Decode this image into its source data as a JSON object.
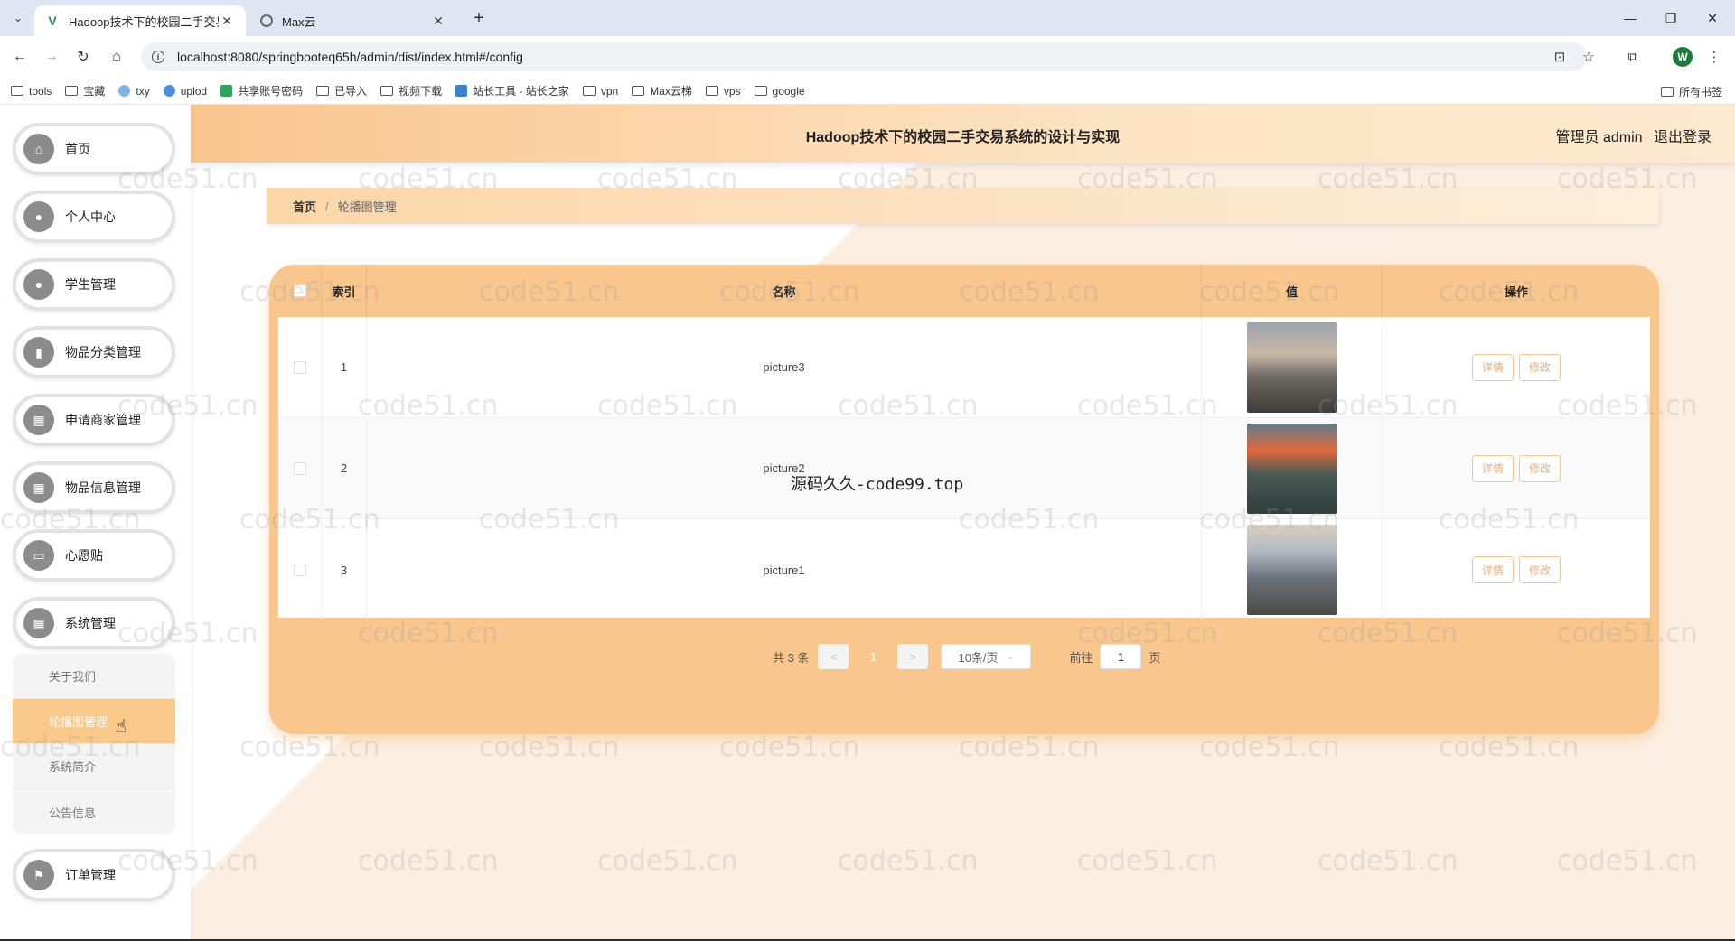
{
  "browser": {
    "tabs": [
      {
        "title": "Hadoop技术下的校园二手交易系统",
        "active": true
      },
      {
        "title": "Max云",
        "active": false
      }
    ],
    "url": "localhost:8080/springbooteq65h/admin/dist/index.html#/config",
    "bookmarks": [
      "tools",
      "宝藏",
      "txy",
      "uplod",
      "共享账号密码",
      "已导入",
      "视频下载",
      "站长工具 - 站长之家",
      "vpn",
      "Max云梯",
      "vps",
      "google"
    ],
    "bookmarks_right": "所有书签",
    "profile_initial": "W"
  },
  "header": {
    "title": "Hadoop技术下的校园二手交易系统的设计与实现",
    "user_label": "管理员 admin",
    "logout": "退出登录"
  },
  "sidebar": {
    "items": [
      {
        "label": "首页",
        "icon": "home-icon"
      },
      {
        "label": "个人中心",
        "icon": "user-icon"
      },
      {
        "label": "学生管理",
        "icon": "student-icon"
      },
      {
        "label": "物品分类管理",
        "icon": "chart-icon"
      },
      {
        "label": "申请商家管理",
        "icon": "grid-icon"
      },
      {
        "label": "物品信息管理",
        "icon": "apps-icon"
      },
      {
        "label": "心愿贴",
        "icon": "note-icon"
      },
      {
        "label": "系统管理",
        "icon": "apps-icon"
      },
      {
        "label": "订单管理",
        "icon": "flag-icon"
      }
    ],
    "submenu": [
      "关于我们",
      "轮播图管理",
      "系统简介",
      "公告信息"
    ]
  },
  "breadcrumb": {
    "home": "首页",
    "current": "轮播图管理"
  },
  "table": {
    "headers": [
      "索引",
      "名称",
      "值",
      "操作"
    ],
    "rows": [
      {
        "index": "1",
        "name": "picture3"
      },
      {
        "index": "2",
        "name": "picture2"
      },
      {
        "index": "3",
        "name": "picture1"
      }
    ],
    "detail_label": "详情",
    "edit_label": "修改"
  },
  "overlay_text": "源码久久-code99.top",
  "pagination": {
    "total": "共 3 条",
    "prev": "<",
    "page": "1",
    "next": ">",
    "page_size": "10条/页",
    "goto_label": "前往",
    "goto_value": "1",
    "goto_suffix": "页"
  },
  "watermark": "code51.cn"
}
